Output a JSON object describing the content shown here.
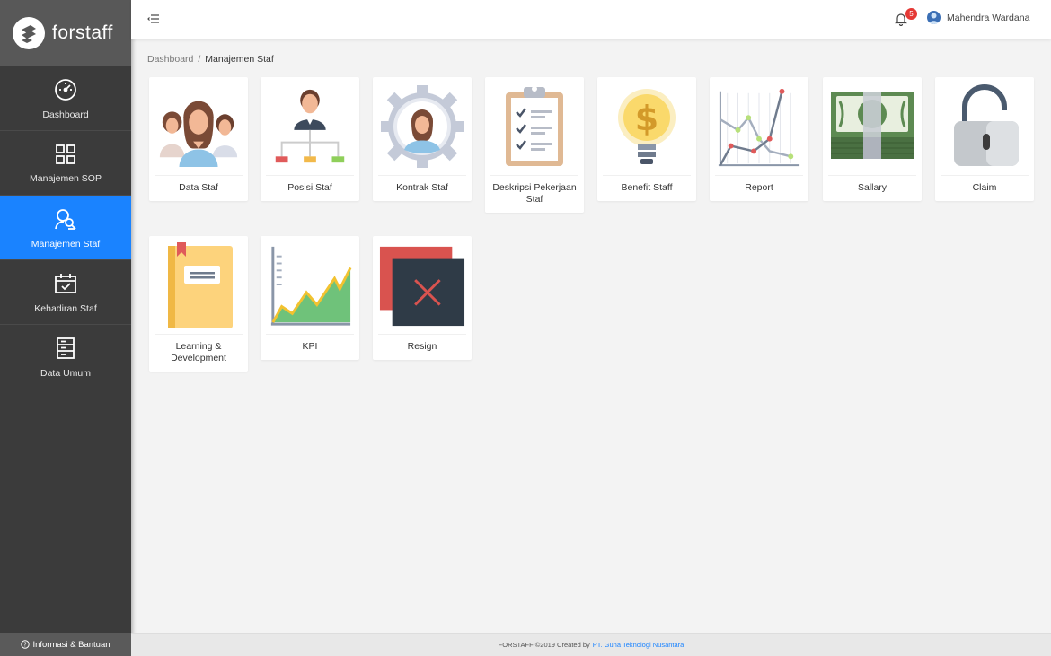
{
  "app": {
    "name": "forstaff"
  },
  "sidebar": {
    "items": [
      {
        "label": "Dashboard",
        "icon": "speedometer-icon"
      },
      {
        "label": "Manajemen SOP",
        "icon": "grid-icon"
      },
      {
        "label": "Manajemen Staf",
        "icon": "user-search-icon",
        "active": true
      },
      {
        "label": "Kehadiran Staf",
        "icon": "calendar-check-icon"
      },
      {
        "label": "Data Umum",
        "icon": "database-icon"
      }
    ],
    "footer_label": "Informasi & Bantuan"
  },
  "topbar": {
    "notification_count": "5",
    "user_name": "Mahendra Wardana"
  },
  "breadcrumb": {
    "root": "Dashboard",
    "separator": "/",
    "current": "Manajemen Staf"
  },
  "cards": [
    {
      "label": "Data Staf",
      "icon": "team-icon"
    },
    {
      "label": "Posisi Staf",
      "icon": "org-chart-icon"
    },
    {
      "label": "Kontrak Staf",
      "icon": "gear-person-icon"
    },
    {
      "label": "Deskripsi Pekerjaan Staf",
      "icon": "clipboard-checklist-icon"
    },
    {
      "label": "Benefit Staff",
      "icon": "lightbulb-dollar-icon"
    },
    {
      "label": "Report",
      "icon": "line-chart-icon"
    },
    {
      "label": "Sallary",
      "icon": "money-icon"
    },
    {
      "label": "Claim",
      "icon": "padlock-icon"
    },
    {
      "label": "Learning & Development",
      "icon": "book-icon"
    },
    {
      "label": "KPI",
      "icon": "area-chart-icon"
    },
    {
      "label": "Resign",
      "icon": "resign-icon"
    }
  ],
  "footer": {
    "text": "FORSTAFF ©2019 Created by",
    "company": "PT. Guna Teknologi Nusantara"
  },
  "colors": {
    "accent": "#1a83ff",
    "sidebar": "#3b3b3b",
    "badge": "#e53935"
  }
}
